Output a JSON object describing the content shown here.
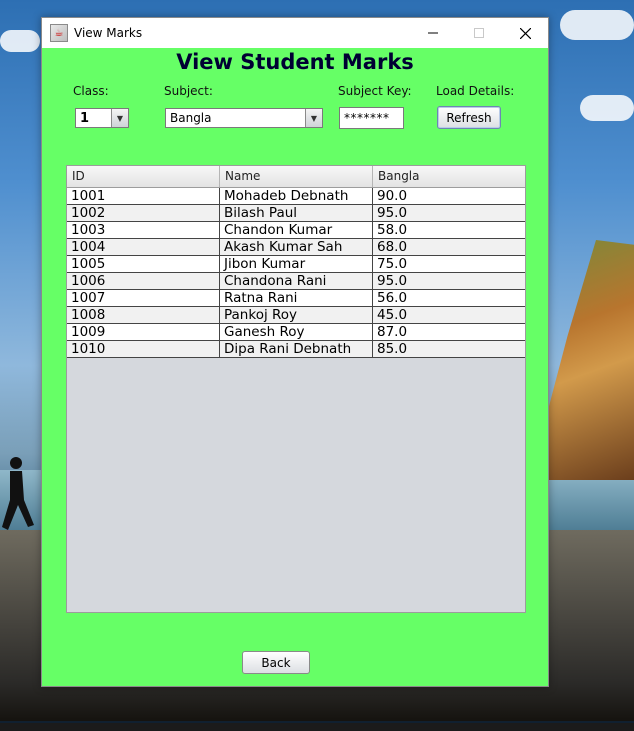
{
  "window": {
    "title": "View Marks",
    "icon": "java-app-icon"
  },
  "page": {
    "heading": "View Student Marks"
  },
  "filters": {
    "class_label": "Class:",
    "class_value": "1",
    "subject_label": "Subject:",
    "subject_value": "Bangla",
    "key_label": "Subject Key:",
    "key_value": "*******",
    "load_label": "Load Details:",
    "refresh_label": "Refresh"
  },
  "table": {
    "columns": [
      "ID",
      "Name",
      "Bangla"
    ],
    "rows": [
      [
        "1001",
        "Mohadeb Debnath",
        "90.0"
      ],
      [
        "1002",
        "Bilash Paul",
        "95.0"
      ],
      [
        "1003",
        "Chandon Kumar",
        "58.0"
      ],
      [
        "1004",
        "Akash Kumar Sah",
        "68.0"
      ],
      [
        "1005",
        "Jibon Kumar",
        "75.0"
      ],
      [
        "1006",
        "Chandona Rani",
        "95.0"
      ],
      [
        "1007",
        "Ratna Rani",
        "56.0"
      ],
      [
        "1008",
        "Pankoj Roy",
        "45.0"
      ],
      [
        "1009",
        "Ganesh Roy",
        "87.0"
      ],
      [
        "1010",
        "Dipa Rani Debnath",
        "85.0"
      ]
    ]
  },
  "footer": {
    "back_label": "Back"
  },
  "colors": {
    "window_bg": "#66ff66",
    "heading": "#000033",
    "table_bg": "#d5d8dd"
  }
}
